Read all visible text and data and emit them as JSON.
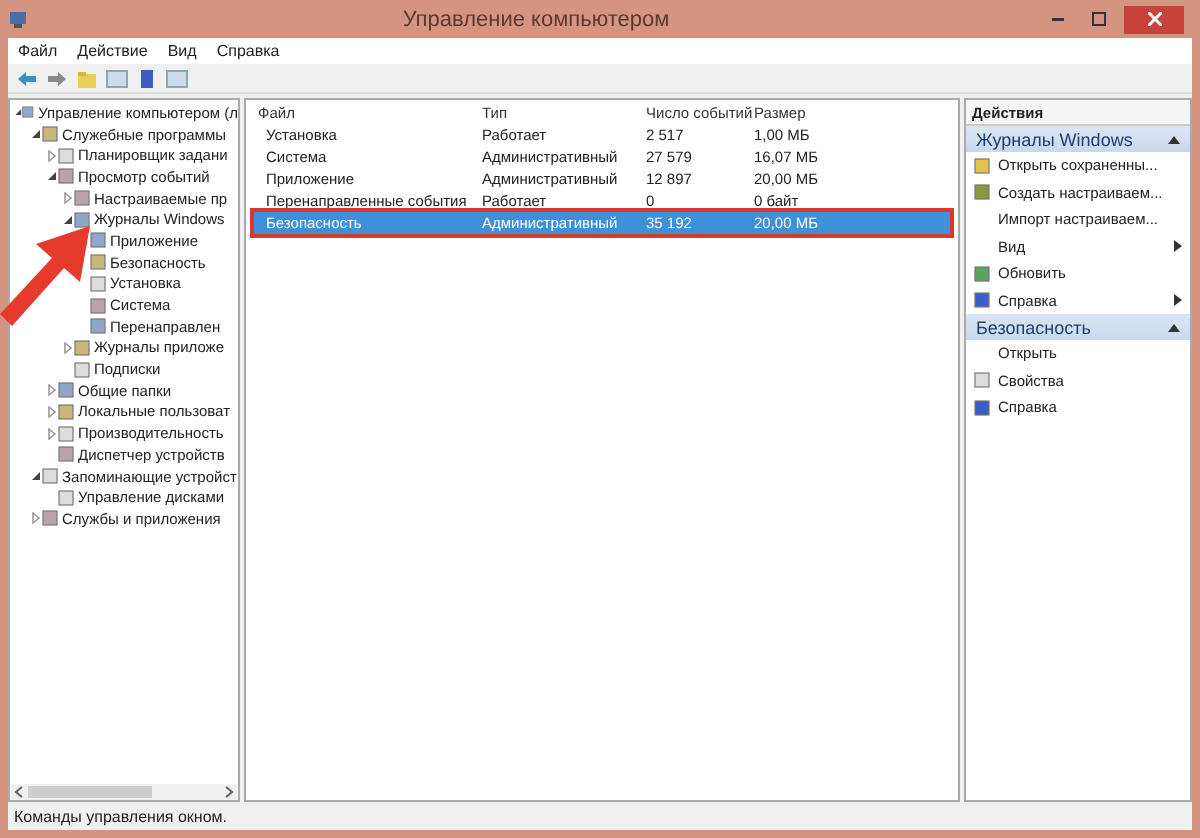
{
  "window": {
    "title": "Управление компьютером"
  },
  "menu": [
    "Файл",
    "Действие",
    "Вид",
    "Справка"
  ],
  "tree": [
    {
      "label": "Управление компьютером (л",
      "expanded": true,
      "children": [
        {
          "label": "Служебные программы",
          "expanded": true,
          "children": [
            {
              "label": "Планировщик задани",
              "expanded": false
            },
            {
              "label": "Просмотр событий",
              "expanded": true,
              "children": [
                {
                  "label": "Настраиваемые пр",
                  "expanded": false
                },
                {
                  "label": "Журналы Windows",
                  "expanded": true,
                  "children": [
                    {
                      "label": "Приложение"
                    },
                    {
                      "label": "Безопасность"
                    },
                    {
                      "label": "Установка"
                    },
                    {
                      "label": "Система"
                    },
                    {
                      "label": "Перенаправлен"
                    }
                  ]
                },
                {
                  "label": "Журналы приложе",
                  "expanded": false
                },
                {
                  "label": "Подписки"
                }
              ]
            },
            {
              "label": "Общие папки",
              "expanded": false
            },
            {
              "label": "Локальные пользоват",
              "expanded": false
            },
            {
              "label": "Производительность",
              "expanded": false
            },
            {
              "label": "Диспетчер устройств"
            }
          ]
        },
        {
          "label": "Запоминающие устройст",
          "expanded": true,
          "children": [
            {
              "label": "Управление дисками"
            }
          ]
        },
        {
          "label": "Службы и приложения",
          "expanded": false
        }
      ]
    }
  ],
  "table": {
    "columns": [
      "Файл",
      "Тип",
      "Число событий",
      "Размер"
    ],
    "rows": [
      {
        "cells": [
          "Установка",
          "Работает",
          "2 517",
          "1,00 МБ"
        ],
        "selected": false
      },
      {
        "cells": [
          "Система",
          "Административный",
          "27 579",
          "16,07 МБ"
        ],
        "selected": false
      },
      {
        "cells": [
          "Приложение",
          "Административный",
          "12 897",
          "20,00 МБ"
        ],
        "selected": false
      },
      {
        "cells": [
          "Перенаправленные события",
          "Работает",
          "0",
          "0 байт"
        ],
        "selected": false
      },
      {
        "cells": [
          "Безопасность",
          "Административный",
          "35 192",
          "20,00 МБ"
        ],
        "selected": true
      }
    ]
  },
  "actions": {
    "title": "Действия",
    "sections": [
      {
        "title": "Журналы Windows",
        "items": [
          {
            "label": "Открыть сохраненны...",
            "submenu": false
          },
          {
            "label": "Создать настраиваем...",
            "submenu": false
          },
          {
            "label": "Импорт настраиваем...",
            "submenu": false
          },
          {
            "label": "Вид",
            "submenu": true
          },
          {
            "label": "Обновить",
            "submenu": false
          },
          {
            "label": "Справка",
            "submenu": true
          }
        ]
      },
      {
        "title": "Безопасность",
        "items": [
          {
            "label": "Открыть",
            "submenu": false
          },
          {
            "label": "Свойства",
            "submenu": false
          },
          {
            "label": "Справка",
            "submenu": false
          }
        ]
      }
    ]
  },
  "status_bar": "Команды управления окном."
}
